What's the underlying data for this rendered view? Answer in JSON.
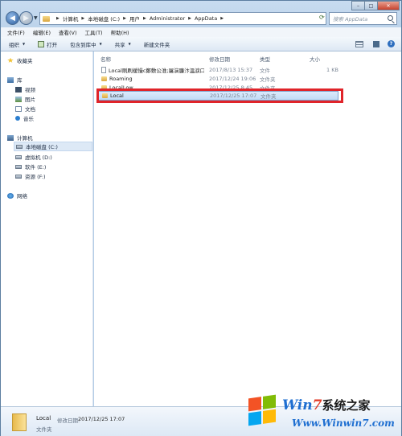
{
  "window": {
    "controls": [
      "–",
      "□",
      "✕"
    ]
  },
  "address": {
    "crumbs": [
      "计算机",
      "本地磁盘 (C:)",
      "用户",
      "Administrator",
      "AppData"
    ],
    "search_placeholder": "搜索 AppData"
  },
  "menu": [
    "文件(F)",
    "编辑(E)",
    "查看(V)",
    "工具(T)",
    "帮助(H)"
  ],
  "toolbar": {
    "organize": "组织",
    "open": "打开",
    "include_library": "包含到库中",
    "share": "共享",
    "new_folder": "新建文件夹"
  },
  "nav": {
    "favorites": "收藏夹",
    "libraries": "库",
    "videos": "视频",
    "pictures": "图片",
    "documents": "文档",
    "music": "音乐",
    "computer": "计算机",
    "drive_c": "本地磁盘 (C:)",
    "drive_d": "虚拟机 (D:)",
    "drive_e": "软件 (E:)",
    "drive_f": "资源 (F:)",
    "network": "网络"
  },
  "columns": {
    "name": "名称",
    "date": "修改日期",
    "type": "类型",
    "size": "大小"
  },
  "files": [
    {
      "name": "Local刷刷缓慢c鄭敷公淮;屠演臁汴溫淚口...",
      "date": "2017/8/13 15:37",
      "type": "文件",
      "size": "1 KB",
      "kind": "file"
    },
    {
      "name": "Roaming",
      "date": "2017/12/24 19:06",
      "type": "文件夹",
      "size": "",
      "kind": "folder"
    },
    {
      "name": "LocalLow",
      "date": "2017/12/25 8:45",
      "type": "文件夹",
      "size": "",
      "kind": "folder"
    },
    {
      "name": "Local",
      "date": "2017/12/25 17:07",
      "type": "文件夹",
      "size": "",
      "kind": "folder"
    }
  ],
  "details": {
    "name": "Local",
    "date_label": "修改日期:",
    "date": "2017/12/25 17:07",
    "type": "文件夹"
  },
  "watermark": {
    "title_prefix": "Win",
    "title_seven": "7",
    "title_cn": "系统之家",
    "url": "Www.Winwin7.com"
  },
  "colors": {
    "highlight_border": "#e0242a",
    "selection": "#c1dbf6"
  }
}
